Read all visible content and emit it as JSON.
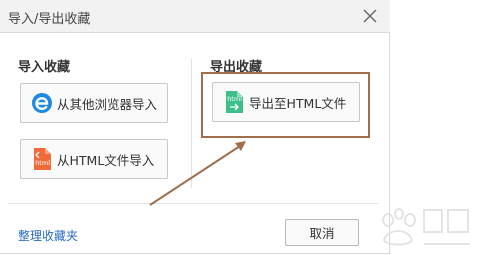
{
  "window": {
    "title": "导入/导出收藏"
  },
  "import_section": {
    "title": "导入收藏",
    "from_browser_label": "从其他浏览器导入",
    "from_html_label": "从HTML文件导入"
  },
  "export_section": {
    "title": "导出收藏",
    "to_html_label": "导出至HTML文件"
  },
  "footer": {
    "organize_link": "整理收藏夹",
    "cancel_label": "取消"
  },
  "icons": {
    "close": "close-icon",
    "browser": "ie-browser-icon",
    "html_import": "html-file-import-icon",
    "html_export": "html-file-export-icon",
    "html_badge_text": "html"
  },
  "colors": {
    "ie_blue": "#1e88e5",
    "html_import_orange": "#f06a3a",
    "html_export_green": "#3cbf8a",
    "annotation_brown": "#a0704e",
    "link_blue": "#2a6bc0"
  }
}
